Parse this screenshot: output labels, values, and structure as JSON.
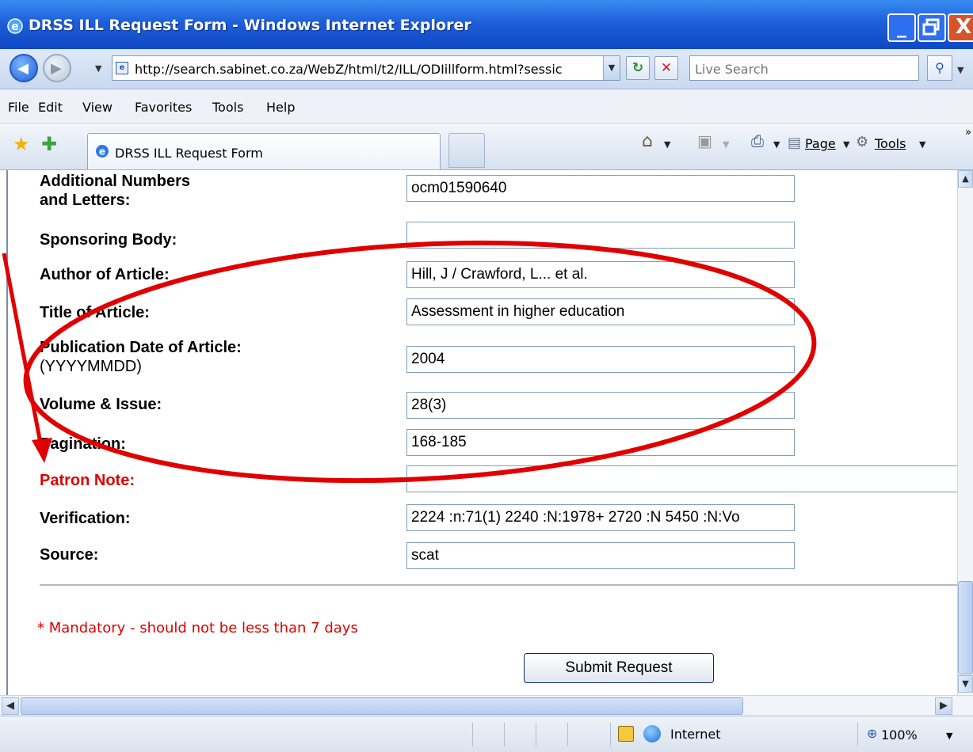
{
  "window": {
    "title": "DRSS ILL Request Form - Windows Internet Explorer",
    "controls": {
      "minimize": "_",
      "close": "X"
    }
  },
  "address": {
    "url": "http://search.sabinet.co.za/WebZ/html/t2/ILL/ODIillform.html?sessic",
    "search_placeholder": "Live Search"
  },
  "menu": [
    "File",
    "Edit",
    "View",
    "Favorites",
    "Tools",
    "Help"
  ],
  "tab": {
    "label": "DRSS ILL Request Form"
  },
  "commands": {
    "page": "Page",
    "tools": "Tools"
  },
  "form": {
    "fields": [
      {
        "label": "Additional Numbers",
        "label2": "and Letters:",
        "value": "ocm01590640"
      },
      {
        "label": "Sponsoring Body:",
        "value": ""
      },
      {
        "label": "Author of Article:",
        "value": "Hill, J / Crawford, L... et al."
      },
      {
        "label": "Title of Article:",
        "value": "Assessment in higher education"
      },
      {
        "label": "Publication Date of Article:",
        "label2": "(YYYYMMDD)",
        "value": "2004"
      },
      {
        "label": "Volume & Issue:",
        "value": "28(3)"
      },
      {
        "label": "Pagination:",
        "value": "168-185"
      },
      {
        "label": "Patron Note:",
        "value": ""
      },
      {
        "label": "Verification:",
        "value": "2224 :n:71(1) 2240 :N:1978+ 2720 :N 5450 :N:Vo"
      },
      {
        "label": "Source:",
        "value": "scat"
      }
    ],
    "mandatory_note": "* Mandatory - should not be less than 7 days",
    "submit_label": "Submit Request"
  },
  "status": {
    "zone": "Internet",
    "zoom": "100%"
  },
  "colors": {
    "titlebar": "#1e5fd8",
    "required_label": "#e00000",
    "annotation": "#e00000"
  }
}
